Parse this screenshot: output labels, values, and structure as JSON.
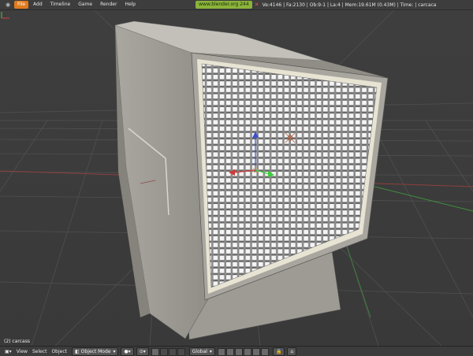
{
  "header": {
    "menu": [
      "File",
      "Add",
      "Timeline",
      "Game",
      "Render",
      "Help"
    ],
    "active_menu": "File",
    "link": "www.blender.org 244",
    "stats": "Ve:4146 | Fa:2130 | Ob:9-1 | La:4 | Mem:19.61M (0.43M) | Time: | carcaca"
  },
  "viewport": {
    "object_label": "(2) carcass",
    "colors": {
      "background": "#393939",
      "grid": "#4d4d4d",
      "axis_x": "#a04040",
      "axis_y": "#40a040",
      "body_front": "#9a9890",
      "body_side": "#b0aea6",
      "screen": "#d4d4d4"
    }
  },
  "footer": {
    "view": "View",
    "select": "Select",
    "object": "Object",
    "mode": "Object Mode",
    "orientation": "Global"
  }
}
